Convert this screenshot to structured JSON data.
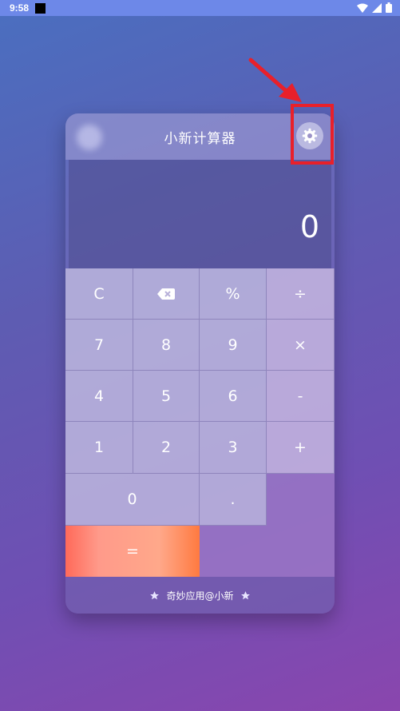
{
  "status_bar": {
    "time": "9:58"
  },
  "app": {
    "title": "小新计算器",
    "display_value": "0",
    "footer_text": "奇妙应用@小新"
  },
  "keys": {
    "clear": "C",
    "percent": "%",
    "divide": "÷",
    "seven": "7",
    "eight": "8",
    "nine": "9",
    "multiply": "×",
    "four": "4",
    "five": "5",
    "six": "6",
    "minus": "-",
    "one": "1",
    "two": "2",
    "three": "3",
    "plus": "+",
    "zero": "0",
    "dot": ".",
    "equals": "="
  },
  "icons": {
    "backspace": "backspace-icon",
    "settings": "gear-icon",
    "footer": "star-icon",
    "status": [
      "wifi-icon",
      "signal-icon",
      "battery-icon"
    ]
  },
  "colors": {
    "highlight": "#e8202a",
    "equals_gradient": "#ff7a40"
  }
}
